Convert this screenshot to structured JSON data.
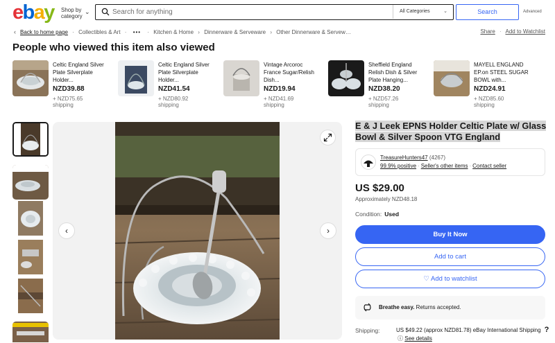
{
  "header": {
    "logo_letters": [
      "e",
      "b",
      "a",
      "y"
    ],
    "shop_by_line1": "Shop by",
    "shop_by_line2": "category",
    "search_placeholder": "Search for anything",
    "category_select": "All Categories",
    "search_button": "Search",
    "advanced_link": "Advanced"
  },
  "breadcrumb": {
    "back": "Back to home page",
    "items": [
      "Collectibles & Art",
      "Kitchen & Home",
      "Dinnerware & Serveware",
      "Other Dinnerware & Serveware"
    ],
    "items_display": [
      "Collectibles & Art",
      "Kitchen & Home",
      "Dinnerware & Serveware",
      "Other Dinnerware & Serveware"
    ],
    "share": "Share",
    "watchlist": "Add to Watchlist"
  },
  "related": {
    "heading": "People who viewed this item also viewed",
    "items": [
      {
        "title": "Celtic England Silver Plate Silverplate Holder...",
        "price": "NZD39.88",
        "shipping_line1": "+ NZD75.65",
        "shipping_line2": "shipping"
      },
      {
        "title": "Celtic England Silver Plate Silverplate Holder...",
        "price": "NZD41.54",
        "shipping_line1": "+ NZD80.92",
        "shipping_line2": "shipping"
      },
      {
        "title": "Vintage Arcoroc France Sugar/Relish Dish...",
        "price": "NZD19.94",
        "shipping_line1": "+ NZD41.69",
        "shipping_line2": "shipping"
      },
      {
        "title": "Sheffield England Relish Dish & Silver Plate Hanging...",
        "price": "NZD38.20",
        "shipping_line1": "+ NZD57.26",
        "shipping_line2": "shipping"
      },
      {
        "title": "MAYELL ENGLAND EP.on STEEL SUGAR BOWL with...",
        "price": "NZD24.91",
        "shipping_line1": "+ NZD85.60",
        "shipping_line2": "shipping"
      }
    ]
  },
  "gallery": {
    "thumb_count": 6,
    "prev_icon": "‹",
    "next_icon": "›"
  },
  "listing": {
    "title": "E & J Leek EPNS Holder Celtic Plate w/ Glass Bowl & Silver Spoon VTG England",
    "seller_name": "TreasureHunters47",
    "seller_count": "(4267)",
    "positive": "99.9% positive",
    "other_items": "Seller's other items",
    "contact": "Contact seller",
    "price": "US $29.00",
    "approx": "Approximately NZD48.18",
    "condition_label": "Condition:",
    "condition_value": "Used",
    "buy_now": "Buy It Now",
    "add_cart": "Add to cart",
    "add_watchlist": "Add to watchlist",
    "returns_bold": "Breathe easy.",
    "returns_text": "Returns accepted.",
    "shipping_label": "Shipping:",
    "shipping_value": "US $49.22 (approx NZD81.78) eBay International Shipping",
    "see_details": "See details",
    "help": "?"
  },
  "colors": {
    "accent": "#3665f3",
    "logo_red": "#e53238",
    "logo_blue": "#0064d2",
    "logo_yellow": "#f5af02",
    "logo_green": "#86b817"
  }
}
